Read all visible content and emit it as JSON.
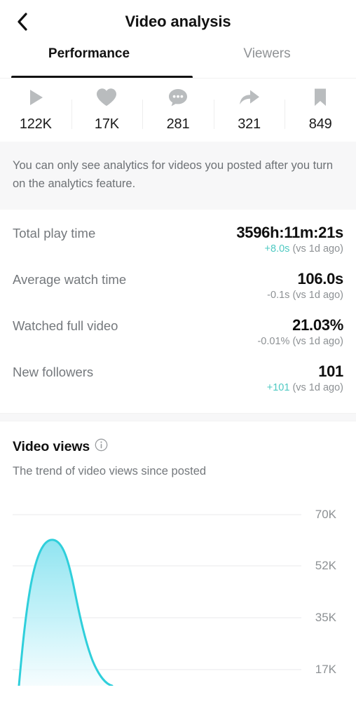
{
  "header": {
    "title": "Video analysis",
    "back_icon": "chevron-left-icon"
  },
  "tabs": [
    {
      "label": "Performance",
      "active": true
    },
    {
      "label": "Viewers",
      "active": false
    }
  ],
  "stats": [
    {
      "icon": "play-icon",
      "name": "plays",
      "value": "122K"
    },
    {
      "icon": "heart-icon",
      "name": "likes",
      "value": "17K"
    },
    {
      "icon": "comment-icon",
      "name": "comments",
      "value": "281"
    },
    {
      "icon": "share-icon",
      "name": "shares",
      "value": "321"
    },
    {
      "icon": "bookmark-icon",
      "name": "saves",
      "value": "849"
    }
  ],
  "notice": {
    "text": "You can only see analytics for videos you posted after you turn on the analytics feature."
  },
  "metrics": [
    {
      "label": "Total play time",
      "value": "3596h:11m:21s",
      "delta": "+8.0s",
      "delta_direction": "up",
      "comparison": "(vs 1d ago)"
    },
    {
      "label": "Average watch time",
      "value": "106.0s",
      "delta": "-0.1s",
      "delta_direction": "down",
      "comparison": "(vs 1d ago)"
    },
    {
      "label": "Watched full video",
      "value": "21.03%",
      "delta": "-0.01%",
      "delta_direction": "down",
      "comparison": "(vs 1d ago)"
    },
    {
      "label": "New followers",
      "value": "101",
      "delta": "+101",
      "delta_direction": "up",
      "comparison": "(vs 1d ago)"
    }
  ],
  "chart_section": {
    "title": "Video views",
    "info_icon": "info-circle-icon",
    "subtitle": "The trend of video views since posted"
  },
  "colors": {
    "accent_teal": "#4ec9c2",
    "chart_stroke": "#2fcfdb",
    "chart_fill_top": "#9fe8f2",
    "chart_fill_bottom": "#eafafd",
    "text_primary": "#111111",
    "text_secondary": "#74787c",
    "gridline": "#f1f1f2",
    "banner_bg": "#f7f7f8"
  },
  "chart_data": {
    "type": "area",
    "title": "Video views",
    "subtitle": "The trend of video views since posted",
    "xlabel": "",
    "ylabel": "",
    "grid": true,
    "legend": false,
    "ylim": [
      0,
      78000
    ],
    "ytick_labels": [
      "70K",
      "52K",
      "35K",
      "17K"
    ],
    "ytick_values": [
      70000,
      52000,
      35000,
      17000
    ],
    "x": [
      0,
      1,
      2,
      3,
      4,
      5,
      6,
      7,
      8,
      9,
      10,
      11,
      12,
      13,
      14,
      15,
      16,
      17,
      18,
      19,
      20
    ],
    "values": [
      2000,
      14000,
      32000,
      50000,
      60000,
      62500,
      60000,
      52000,
      43000,
      34000,
      27000,
      21000,
      16000,
      12000,
      8500,
      0,
      0,
      0,
      0,
      0,
      0
    ],
    "peak_value": 62500,
    "series": [
      {
        "name": "Video views",
        "values": [
          2000,
          14000,
          32000,
          50000,
          60000,
          62500,
          60000,
          52000,
          43000,
          34000,
          27000,
          21000,
          16000,
          12000,
          8500,
          0,
          0,
          0,
          0,
          0,
          0
        ]
      }
    ],
    "note": "Chart is clipped at the bottom edge of the screenshot; curve occupies the left portion of the plot area."
  }
}
